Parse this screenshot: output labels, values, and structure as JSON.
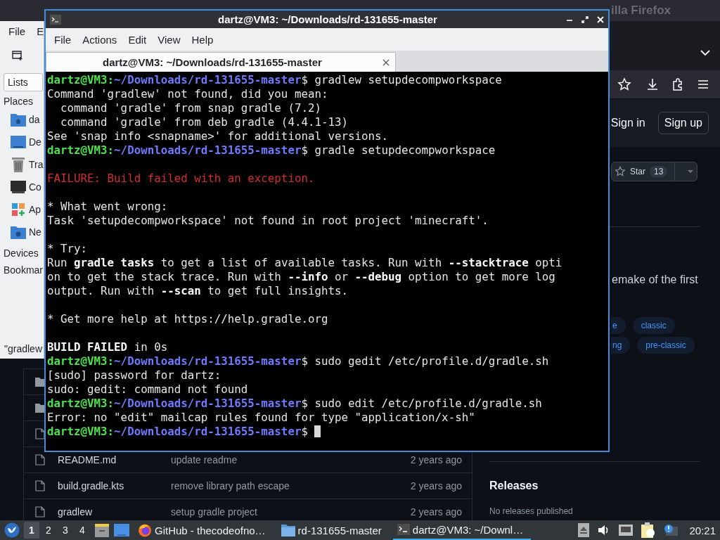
{
  "firefox": {
    "title_fragment": "illa Firefox",
    "header": {
      "sign_in": "Sign in",
      "sign_up": "Sign up"
    },
    "star": {
      "label": "Star",
      "count": "13"
    },
    "about_fragment": "emake of the first",
    "topics": [
      [
        "e",
        "classic"
      ],
      [
        "ng",
        "pre-classic"
      ]
    ],
    "files": [
      {
        "kind": "folder"
      },
      {
        "kind": "folder"
      },
      {
        "kind": "file"
      },
      {
        "kind": "file",
        "name": "README.md",
        "message": "update readme",
        "age": "2 years ago"
      },
      {
        "kind": "file",
        "name": "build.gradle.kts",
        "message": "remove library path escape",
        "age": "2 years ago"
      },
      {
        "kind": "file",
        "name": "gradlew",
        "message": "setup gradle project",
        "age": "2 years ago"
      }
    ],
    "releases": {
      "title": "Releases",
      "empty": "No releases published"
    }
  },
  "file_manager": {
    "menu": [
      "File",
      "E"
    ],
    "view_select": "Lists",
    "sections": [
      {
        "label": "Places",
        "items": [
          {
            "kind": "home",
            "label": "da"
          },
          {
            "kind": "desktop",
            "label": "De"
          },
          {
            "kind": "trash",
            "label": "Tra"
          },
          {
            "kind": "computer",
            "label": "Co"
          },
          {
            "kind": "apps",
            "label": "Ap"
          },
          {
            "kind": "network",
            "label": "Ne"
          }
        ]
      },
      {
        "label": "Devices"
      },
      {
        "label": "Bookmar"
      }
    ],
    "status": "\"gradlew"
  },
  "terminal": {
    "title": "dartz@VM3: ~/Downloads/rd-131655-master",
    "menu": [
      "File",
      "Actions",
      "Edit",
      "View",
      "Help"
    ],
    "tab": "dartz@VM3: ~/Downloads/rd-131655-master",
    "lines": [
      {
        "kind": "prompt",
        "user": "dartz@VM3:",
        "path": "~/Downloads/rd-131655-master",
        "command": "$ gradlew setupdecompworkspace",
        "cursor": false
      },
      {
        "kind": "output",
        "text": "Command 'gradlew' not found, did you mean:"
      },
      {
        "kind": "output",
        "text": "  command 'gradle' from snap gradle (7.2)"
      },
      {
        "kind": "output",
        "text": "  command 'gradle' from deb gradle (4.4.1-13)"
      },
      {
        "kind": "output",
        "text": "See 'snap info <snapname>' for additional versions."
      },
      {
        "kind": "prompt",
        "user": "dartz@VM3:",
        "path": "~/Downloads/rd-131655-master",
        "command": "$ gradle setupdecompworkspace",
        "cursor": false
      },
      {
        "kind": "blank"
      },
      {
        "kind": "error",
        "text": "FAILURE: Build failed with an exception."
      },
      {
        "kind": "blank"
      },
      {
        "kind": "output",
        "text": "* What went wrong:"
      },
      {
        "kind": "output",
        "text": "Task 'setupdecompworkspace' not found in root project 'minecraft'."
      },
      {
        "kind": "blank"
      },
      {
        "kind": "output",
        "text": "* Try:"
      },
      {
        "kind": "output",
        "text": "Run **gradle tasks** to get a list of available tasks. Run with **--stacktrace** opti"
      },
      {
        "kind": "output",
        "text": "on to get the stack trace. Run with **--info** or **--debug** option to get more log"
      },
      {
        "kind": "output",
        "text": "output. Run with **--scan** to get full insights."
      },
      {
        "kind": "blank"
      },
      {
        "kind": "output",
        "text": "* Get more help at https://help.gradle.org"
      },
      {
        "kind": "blank"
      },
      {
        "kind": "status",
        "label": "BUILD FAILED",
        "text": "in 0s"
      },
      {
        "kind": "prompt",
        "user": "dartz@VM3:",
        "path": "~/Downloads/rd-131655-master",
        "command": "$ sudo gedit /etc/profile.d/gradle.sh",
        "cursor": false
      },
      {
        "kind": "output",
        "text": "[sudo] password for dartz:"
      },
      {
        "kind": "output",
        "text": "sudo: gedit: command not found"
      },
      {
        "kind": "prompt",
        "user": "dartz@VM3:",
        "path": "~/Downloads/rd-131655-master",
        "command": "$ sudo edit /etc/profile.d/gradle.sh",
        "cursor": false
      },
      {
        "kind": "output",
        "text": "Error: no \"edit\" mailcap rules found for type \"application/x-sh\""
      },
      {
        "kind": "prompt",
        "user": "dartz@VM3:",
        "path": "~/Downloads/rd-131655-master",
        "command": "$",
        "cursor": true
      }
    ]
  },
  "taskbar": {
    "workspaces": [
      {
        "label": "1",
        "selected": true
      },
      {
        "label": "2",
        "selected": false
      },
      {
        "label": "3",
        "selected": false
      },
      {
        "label": "4",
        "selected": false
      }
    ],
    "tasks": [
      {
        "kind": "firefox",
        "label": "GitHub - thecodeofno…",
        "selected": false
      },
      {
        "kind": "folder",
        "label": "rd-131655-master",
        "selected": false
      },
      {
        "kind": "terminal",
        "label": "dartz@VM3: ~/Downl…",
        "selected": true
      }
    ],
    "clock": "20:21"
  }
}
